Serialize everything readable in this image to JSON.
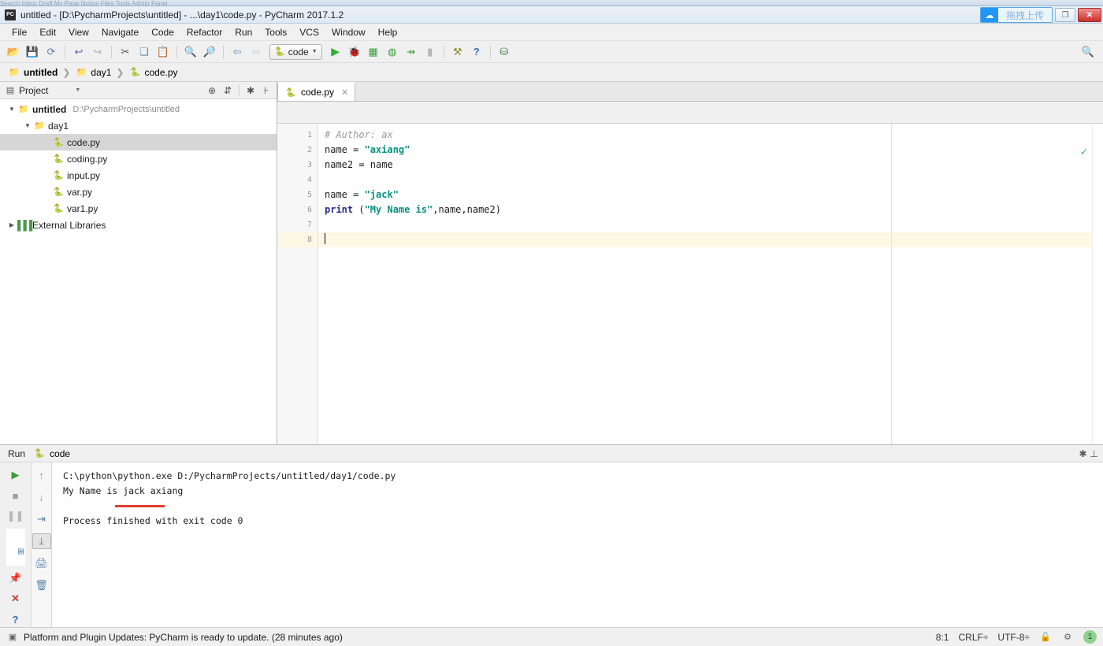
{
  "window": {
    "title": "untitled - [D:\\PycharmProjects\\untitled] - ...\\day1\\code.py - PyCharm 2017.1.2",
    "app_icon": "PC",
    "netdisk_label": "拖拽上传",
    "netdisk_icon": "cloud-icon",
    "minimize_label": "❐",
    "close_label": "✕"
  },
  "menu": {
    "items": [
      "File",
      "Edit",
      "View",
      "Navigate",
      "Code",
      "Refactor",
      "Run",
      "Tools",
      "VCS",
      "Window",
      "Help"
    ]
  },
  "toolbar": {
    "items": [
      {
        "name": "open-icon",
        "glyph": "📂"
      },
      {
        "name": "save-all-icon",
        "glyph": "💾"
      },
      {
        "name": "sync-icon",
        "glyph": "⟳"
      },
      {
        "name": "undo-icon",
        "glyph": "↩"
      },
      {
        "name": "redo-icon",
        "glyph": "↪"
      },
      {
        "name": "cut-icon",
        "glyph": "✂"
      },
      {
        "name": "copy-icon",
        "glyph": "❐"
      },
      {
        "name": "paste-icon",
        "glyph": "📋"
      },
      {
        "name": "find-icon",
        "glyph": "🔍"
      },
      {
        "name": "replace-icon",
        "glyph": "🔎"
      },
      {
        "name": "back-icon",
        "glyph": "⇦"
      },
      {
        "name": "forward-icon",
        "glyph": "⇨"
      }
    ],
    "run_config": {
      "label": "code",
      "icon": "python-icon",
      "caret": "▼"
    },
    "run_buttons": [
      {
        "name": "run-icon",
        "glyph": "▶",
        "color": "#2faf2f"
      },
      {
        "name": "debug-icon",
        "glyph": "🐞",
        "color": "#3a9e3a"
      },
      {
        "name": "coverage-icon",
        "glyph": "▦",
        "color": "#3a9e3a"
      },
      {
        "name": "profile-icon",
        "glyph": "◍",
        "color": "#3a9e3a"
      },
      {
        "name": "attach-icon",
        "glyph": "⇶",
        "color": "#3a9e3a"
      },
      {
        "name": "stop-icon",
        "glyph": "▮",
        "color": "#b4b4b4"
      }
    ],
    "extra_buttons": [
      {
        "name": "settings-wrench-icon",
        "glyph": "⚒",
        "color": "#7a7a2a"
      },
      {
        "name": "help-icon",
        "glyph": "?",
        "color": "#3a6fb5"
      },
      {
        "name": "vcs-update-icon",
        "glyph": "⛁",
        "color": "#4a7a4a"
      }
    ],
    "search_icon": "search-icon"
  },
  "breadcrumb": {
    "items": [
      {
        "label": "untitled",
        "icon": "folder-icon",
        "bold": true
      },
      {
        "label": "day1",
        "icon": "folder-icon",
        "bold": false
      },
      {
        "label": "code.py",
        "icon": "python-icon",
        "bold": false
      }
    ],
    "separator": "❯"
  },
  "project_panel": {
    "title": "Project",
    "panel_icon": "project-icon",
    "caret": "▼",
    "tools": [
      {
        "name": "locate-target-icon",
        "glyph": "⊕"
      },
      {
        "name": "collapse-all-icon",
        "glyph": "⇵"
      },
      {
        "name": "settings-gear-icon",
        "glyph": "✱"
      },
      {
        "name": "hide-panel-icon",
        "glyph": "⊦"
      }
    ],
    "tree": [
      {
        "name": "untitled",
        "path": "D:\\PycharmProjects\\untitled",
        "indent": 0,
        "arrow": "▼",
        "icon": "folder-icon",
        "bold": true,
        "selected": false
      },
      {
        "name": "day1",
        "path": "",
        "indent": 1,
        "arrow": "▼",
        "icon": "folder-icon",
        "bold": false,
        "selected": false
      },
      {
        "name": "code.py",
        "path": "",
        "indent": 2,
        "arrow": "",
        "icon": "python-icon",
        "bold": false,
        "selected": true
      },
      {
        "name": "coding.py",
        "path": "",
        "indent": 2,
        "arrow": "",
        "icon": "python-icon",
        "bold": false,
        "selected": false
      },
      {
        "name": "input.py",
        "path": "",
        "indent": 2,
        "arrow": "",
        "icon": "python-icon",
        "bold": false,
        "selected": false
      },
      {
        "name": "var.py",
        "path": "",
        "indent": 2,
        "arrow": "",
        "icon": "python-icon",
        "bold": false,
        "selected": false
      },
      {
        "name": "var1.py",
        "path": "",
        "indent": 2,
        "arrow": "",
        "icon": "python-icon",
        "bold": false,
        "selected": false
      },
      {
        "name": "External Libraries",
        "path": "",
        "indent": 0,
        "arrow": "▶",
        "icon": "libraries-icon",
        "bold": false,
        "selected": false
      }
    ]
  },
  "editor": {
    "tab": {
      "label": "code.py",
      "icon": "python-icon",
      "close": "✕"
    },
    "inspection_icon": "inspection-ok-check",
    "lines": [
      {
        "num": "1",
        "highlight": false,
        "tokens": [
          {
            "t": "# Author: ax",
            "c": "comment"
          }
        ]
      },
      {
        "num": "2",
        "highlight": false,
        "tokens": [
          {
            "t": "name = ",
            "c": "plain"
          },
          {
            "t": "\"axiang\"",
            "c": "string"
          }
        ]
      },
      {
        "num": "3",
        "highlight": false,
        "tokens": [
          {
            "t": "name2 = name",
            "c": "plain"
          }
        ]
      },
      {
        "num": "4",
        "highlight": false,
        "tokens": [
          {
            "t": "",
            "c": "plain"
          }
        ]
      },
      {
        "num": "5",
        "highlight": false,
        "tokens": [
          {
            "t": "name = ",
            "c": "plain"
          },
          {
            "t": "\"jack\"",
            "c": "string"
          }
        ]
      },
      {
        "num": "6",
        "highlight": false,
        "tokens": [
          {
            "t": "print",
            "c": "kw"
          },
          {
            "t": " (",
            "c": "plain"
          },
          {
            "t": "\"My Name is\"",
            "c": "string"
          },
          {
            "t": ",name,name2)",
            "c": "plain"
          }
        ]
      },
      {
        "num": "7",
        "highlight": false,
        "tokens": [
          {
            "t": "",
            "c": "plain"
          }
        ]
      },
      {
        "num": "8",
        "highlight": true,
        "tokens": [
          {
            "t": "",
            "c": "caret"
          }
        ]
      }
    ]
  },
  "run_panel": {
    "label": "Run",
    "tab_label": "code",
    "tab_icon": "python-icon",
    "tools": [
      {
        "name": "run-settings-gear-icon",
        "glyph": "✱"
      },
      {
        "name": "hide-panel-icon",
        "glyph": "⊥"
      }
    ],
    "sidebar_primary": [
      {
        "name": "rerun-icon",
        "glyph": "▶",
        "cls": "run"
      },
      {
        "name": "stop-icon",
        "glyph": "■",
        "cls": "stop"
      },
      {
        "name": "pause-icon",
        "glyph": "❚❚",
        "cls": "pause"
      },
      {
        "name": "console-icon",
        "glyph": "▤",
        "cls": "console"
      },
      {
        "name": "pin-tab-icon",
        "glyph": "📌",
        "cls": "pin"
      },
      {
        "name": "close-icon",
        "glyph": "✕",
        "cls": "close"
      },
      {
        "name": "help-icon",
        "glyph": "?",
        "cls": "help"
      }
    ],
    "sidebar_secondary": [
      {
        "name": "up-arrow-icon",
        "glyph": "↑",
        "cls": "arrow"
      },
      {
        "name": "down-arrow-icon",
        "glyph": "↓",
        "cls": "arrow"
      },
      {
        "name": "soft-wrap-icon",
        "glyph": "⇥",
        "cls": "wrap"
      },
      {
        "name": "scroll-to-end-icon",
        "glyph": "⤓",
        "cls": "scroll"
      },
      {
        "name": "print-icon",
        "glyph": "🖨",
        "cls": "print"
      },
      {
        "name": "clear-all-icon",
        "glyph": "🗑",
        "cls": "trash"
      }
    ],
    "console_lines": [
      "C:\\python\\python.exe D:/PycharmProjects/untitled/day1/code.py",
      "My Name is jack axiang",
      "",
      "Process finished with exit code 0"
    ],
    "annotation_color": "#e03e30"
  },
  "status_bar": {
    "icon": "event-log-icon",
    "message": "Platform and Plugin Updates: PyCharm is ready to update. (28 minutes ago)",
    "caret_position": "8:1",
    "line_separator": "CRLF÷",
    "encoding": "UTF-8÷",
    "lock_icon": "lock-icon",
    "inspector_icon": "inspector-icon",
    "badge_count": "1"
  },
  "background_strip": {
    "ghost_text": "Search        Inbox        Draft        My Page        Notice        Files        Tools        Admin        Panel"
  }
}
